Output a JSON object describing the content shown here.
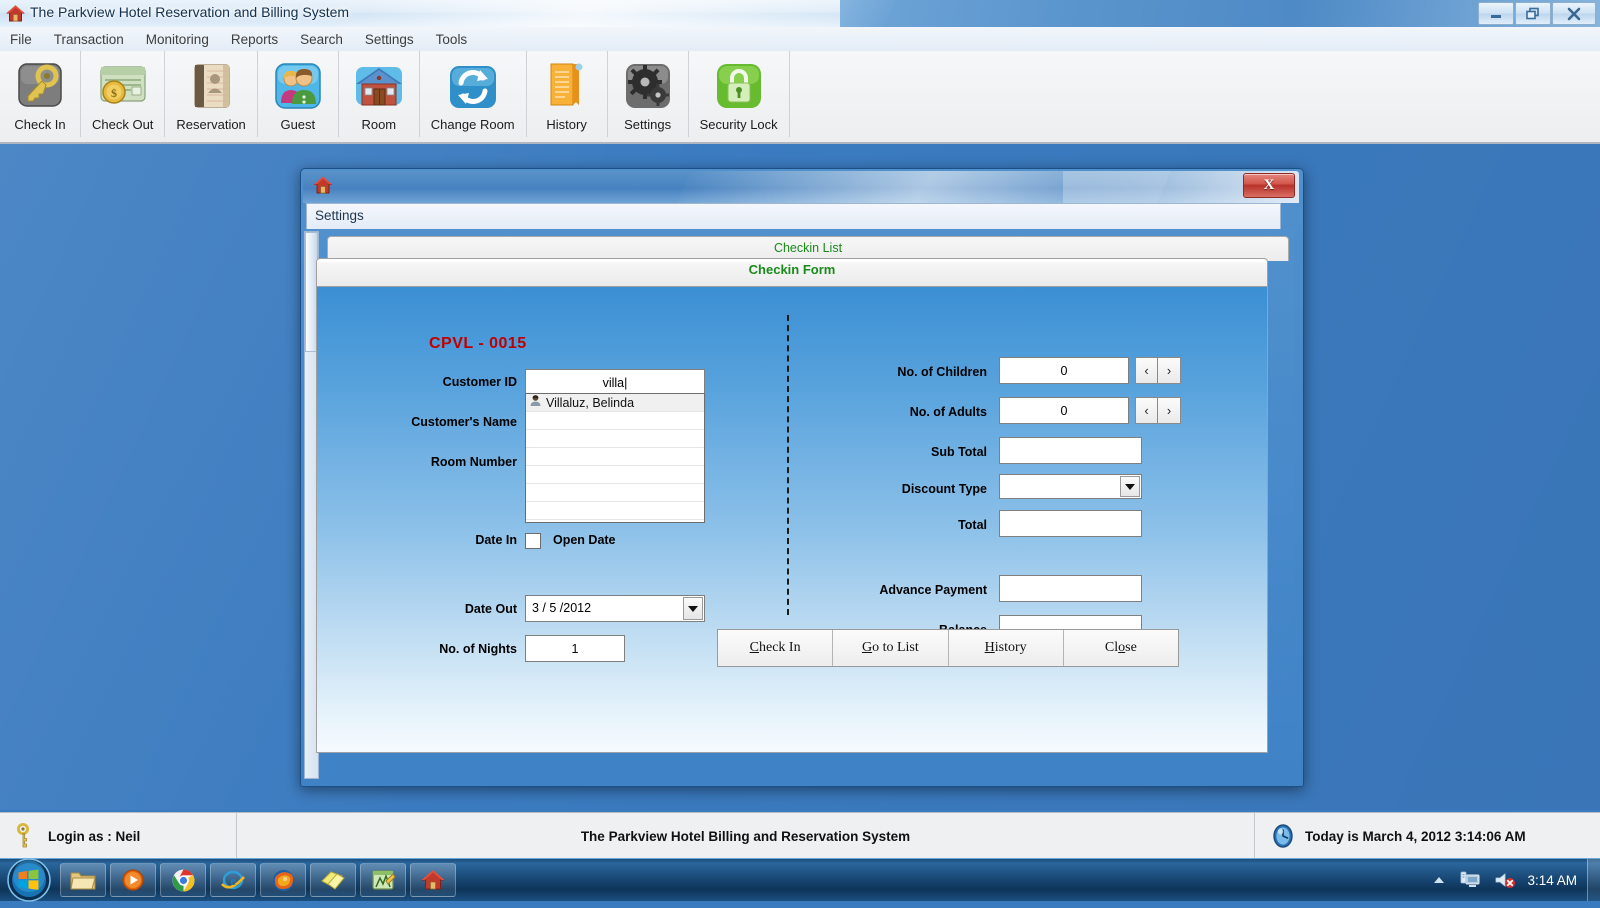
{
  "window": {
    "title": "The Parkview Hotel Reservation and Billing System",
    "icon": "home-icon",
    "controls": [
      {
        "name": "minimize",
        "glyph": "minimize-icon"
      },
      {
        "name": "restore",
        "glyph": "restore-icon"
      },
      {
        "name": "close",
        "glyph": "close-icon"
      }
    ]
  },
  "menubar": {
    "items": [
      {
        "label": "File"
      },
      {
        "label": "Transaction"
      },
      {
        "label": "Monitoring"
      },
      {
        "label": "Reports"
      },
      {
        "label": "Search"
      },
      {
        "label": "Settings"
      },
      {
        "label": "Tools"
      }
    ]
  },
  "toolbar": {
    "items": [
      {
        "label": "Check In",
        "icon": "key-icon"
      },
      {
        "label": "Check Out",
        "icon": "money-icon"
      },
      {
        "label": "Reservation",
        "icon": "address-book-icon"
      },
      {
        "label": "Guest",
        "icon": "people-icon"
      },
      {
        "label": "Room",
        "icon": "house-icon"
      },
      {
        "label": "Change Room",
        "icon": "refresh-icon"
      },
      {
        "label": "History",
        "icon": "bookmark-document-icon"
      },
      {
        "label": "Settings",
        "icon": "gears-icon"
      },
      {
        "label": "Security Lock",
        "icon": "padlock-icon"
      }
    ]
  },
  "dialog": {
    "icon": "home-icon",
    "close_label": "X",
    "settings_bar": "Settings",
    "tab_checkin_list": "Checkin List",
    "form_header": "Checkin Form",
    "code": "CPVL - 0015",
    "left_fields": [
      {
        "label": "Customer ID",
        "value": ""
      },
      {
        "label": "Customer's Name",
        "value": "villa"
      },
      {
        "label": "Room Number",
        "value": ""
      },
      {
        "label": "Date In",
        "value": ""
      },
      {
        "label": "Date Out",
        "value": "3 / 5 /2012"
      },
      {
        "label": "No. of Nights",
        "value": "1"
      }
    ],
    "open_date": {
      "label": "Open Date",
      "checked": false
    },
    "autocomplete": {
      "icon": "person-icon",
      "items": [
        "Villaluz, Belinda"
      ],
      "empty_rows": 6
    },
    "right_fields": [
      {
        "label": "No. of Children",
        "value": "0",
        "spinner": true,
        "prev": "‹",
        "next": "›"
      },
      {
        "label": "No. of Adults",
        "value": "0",
        "spinner": true,
        "prev": "‹",
        "next": "›"
      },
      {
        "label": "Sub Total",
        "value": ""
      },
      {
        "label": "Discount Type",
        "value": "",
        "combo": true
      },
      {
        "label": "Total",
        "value": ""
      },
      {
        "label": "Advance Payment",
        "value": ""
      },
      {
        "label": "Balance",
        "value": ""
      }
    ],
    "buttons": [
      {
        "accel": "C",
        "rest": "heck In"
      },
      {
        "accel": "G",
        "rest": "o to List"
      },
      {
        "accel": "H",
        "rest": "istory"
      },
      {
        "pre": "Cl",
        "accel": "o",
        "rest": "se"
      }
    ]
  },
  "statusbar": {
    "login": "Login as : Neil",
    "login_icon": "key-icon",
    "center": "The Parkview Hotel Billing and Reservation System",
    "time_icon": "clock-icon",
    "datetime": "Today is March 4, 2012  3:14:06 AM"
  },
  "taskbar": {
    "start_icon": "windows-start-icon",
    "apps": [
      {
        "name": "explorer-icon"
      },
      {
        "name": "media-player-icon"
      },
      {
        "name": "chrome-icon"
      },
      {
        "name": "internet-explorer-icon"
      },
      {
        "name": "firefox-icon"
      },
      {
        "name": "sticky-notes-icon"
      },
      {
        "name": "visual-basic-icon"
      },
      {
        "name": "parkview-app-icon"
      }
    ],
    "tray": {
      "chevron": "show-hidden-icons-icon",
      "network": "network-icon",
      "volume": "volume-muted-icon",
      "time": "3:14 AM"
    }
  },
  "colors": {
    "desktop": "#3a7bc0",
    "code_red": "#c00000",
    "tab_green": "#1a8a1a",
    "dialog_blue": "#4f90cd"
  }
}
